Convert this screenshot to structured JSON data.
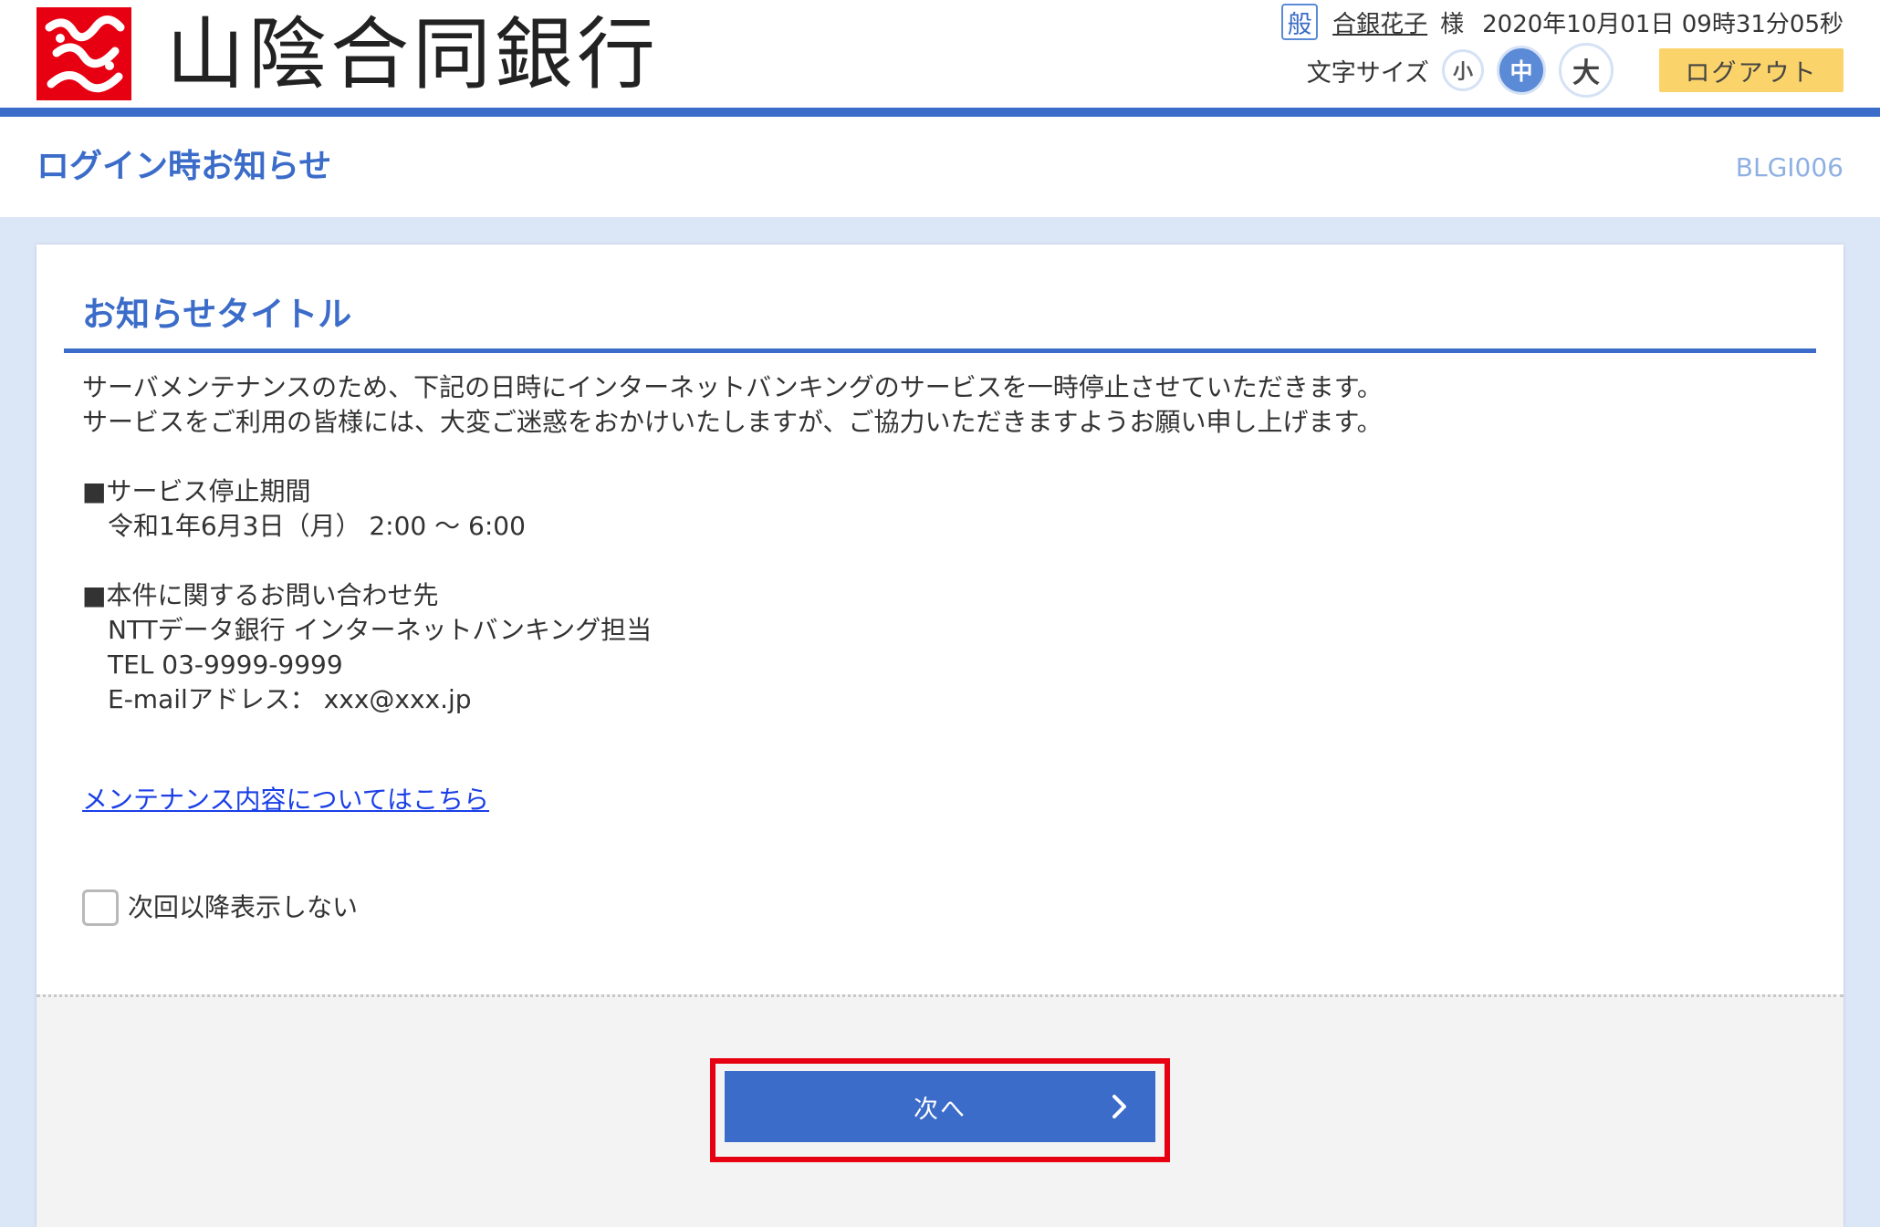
{
  "bank": {
    "name": "山陰合同銀行"
  },
  "user": {
    "badge": "般",
    "name": "合銀花子",
    "honorific": "様",
    "datetime": "2020年10月01日 09時31分05秒"
  },
  "font_size": {
    "label": "文字サイズ",
    "small": "小",
    "medium": "中",
    "large": "大",
    "selected": "中"
  },
  "header": {
    "logout_label": "ログアウト"
  },
  "page": {
    "title": "ログイン時お知らせ",
    "screen_id": "BLGI006"
  },
  "notice": {
    "title": "お知らせタイトル",
    "lines": [
      "サーバメンテナンスのため、下記の日時にインターネットバンキングのサービスを一時停止させていただきます。",
      "サービスをご利用の皆様には、大変ご迷惑をおかけいたしますが、ご協力いただきますようお願い申し上げます。",
      "",
      "■サービス停止期間",
      "　令和1年6月3日（月） 2:00 ～ 6:00",
      "",
      "■本件に関するお問い合わせ先",
      "　NTTデータ銀行 インターネットバンキング担当",
      "　TEL 03-9999-9999",
      "　E-mailアドレス： xxx@xxx.jp"
    ],
    "link_label": "メンテナンス内容についてはこちら",
    "checkbox_label": "次回以降表示しない",
    "checkbox_checked": false
  },
  "footer": {
    "next_label": "次へ"
  },
  "colors": {
    "brand_red": "#e60012",
    "primary_blue": "#3b6cc9",
    "logout_yellow": "#fad36b",
    "background_blue": "#dbe6f7"
  }
}
